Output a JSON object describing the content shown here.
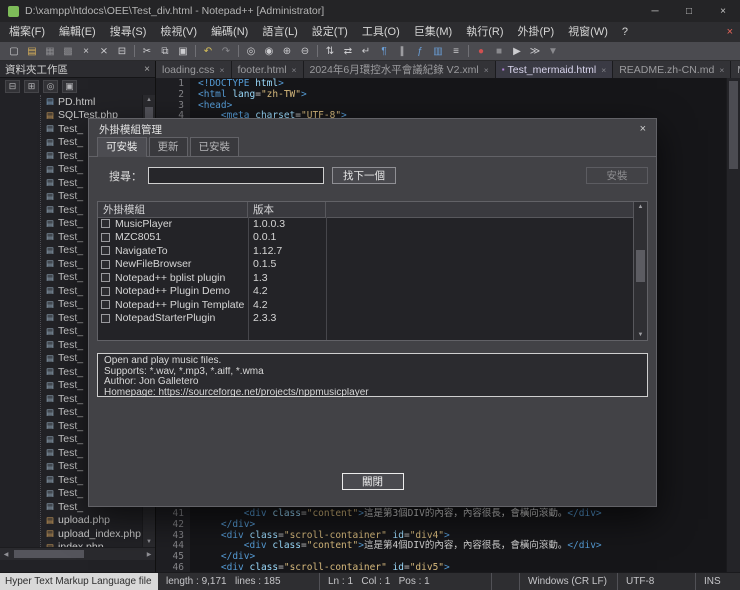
{
  "window": {
    "title": "D:\\xampp\\htdocs\\OEE\\Test_div.html - Notepad++ [Administrator]",
    "minimize": "─",
    "maximize": "□",
    "close": "×",
    "menubar_close": "×"
  },
  "icons": {
    "close": "×",
    "scroll_left": "◀",
    "scroll_right": "▶",
    "scroll_up": "▲",
    "scroll_down": "▼",
    "file": "▤",
    "tab_state": "▪"
  },
  "menu": {
    "items": [
      {
        "id": "file",
        "label": "檔案(F)"
      },
      {
        "id": "edit",
        "label": "編輯(E)"
      },
      {
        "id": "search",
        "label": "搜尋(S)"
      },
      {
        "id": "view",
        "label": "檢視(V)"
      },
      {
        "id": "encoding",
        "label": "編碼(N)"
      },
      {
        "id": "language",
        "label": "語言(L)"
      },
      {
        "id": "settings",
        "label": "設定(T)"
      },
      {
        "id": "tools",
        "label": "工具(O)"
      },
      {
        "id": "macro",
        "label": "巨集(M)"
      },
      {
        "id": "run",
        "label": "執行(R)"
      },
      {
        "id": "plugins",
        "label": "外掛(P)"
      },
      {
        "id": "window",
        "label": "視窗(W)"
      },
      {
        "id": "help",
        "label": "?"
      }
    ]
  },
  "toolbar": {
    "icons": [
      {
        "name": "new-file",
        "glyph": "▢"
      },
      {
        "name": "open-file",
        "glyph": "▤",
        "color": "#d8b05a"
      },
      {
        "name": "save",
        "glyph": "▦",
        "color": "#8a8a8e"
      },
      {
        "name": "save-all",
        "glyph": "▩",
        "color": "#8a8a8e"
      },
      {
        "name": "close-file",
        "glyph": "×"
      },
      {
        "name": "close-all",
        "glyph": "⨯"
      },
      {
        "name": "print",
        "glyph": "⊟"
      },
      {
        "sep": true
      },
      {
        "name": "cut",
        "glyph": "✂"
      },
      {
        "name": "copy",
        "glyph": "⧉"
      },
      {
        "name": "paste",
        "glyph": "▣"
      },
      {
        "sep": true
      },
      {
        "name": "undo",
        "glyph": "↶",
        "color": "#d8c05a"
      },
      {
        "name": "redo",
        "glyph": "↷",
        "color": "#8a8a8e"
      },
      {
        "sep": true
      },
      {
        "name": "find",
        "glyph": "◎"
      },
      {
        "name": "replace",
        "glyph": "◉"
      },
      {
        "name": "zoom-in",
        "glyph": "⊕"
      },
      {
        "name": "zoom-out",
        "glyph": "⊖"
      },
      {
        "sep": true
      },
      {
        "name": "sync-vertical-scroll",
        "glyph": "⇅"
      },
      {
        "name": "sync-horizontal-scroll",
        "glyph": "⇄"
      },
      {
        "name": "word-wrap",
        "glyph": "↵"
      },
      {
        "name": "show-all-characters",
        "glyph": "¶",
        "color": "#6a9fd8"
      },
      {
        "name": "indent-guide",
        "glyph": "∥"
      },
      {
        "name": "function-list",
        "glyph": "ƒ",
        "color": "#6a9fd8"
      },
      {
        "name": "document-map",
        "glyph": "▥",
        "color": "#6a9fd8"
      },
      {
        "name": "document-switcher",
        "glyph": "≡"
      },
      {
        "sep": true
      },
      {
        "name": "record-macro",
        "glyph": "●",
        "color": "#d05050"
      },
      {
        "name": "stop-macro",
        "glyph": "■",
        "color": "#8a8a8e"
      },
      {
        "name": "play-macro",
        "glyph": "▶"
      },
      {
        "name": "run-macro-multiple-times",
        "glyph": "≫"
      },
      {
        "name": "save-macro",
        "glyph": "▼",
        "color": "#8a8a8e"
      }
    ]
  },
  "tabbar": {
    "tabs": [
      {
        "label": "loading.css",
        "active": false
      },
      {
        "label": "footer.html",
        "active": false
      },
      {
        "label": "2024年6月環控水平會議紀錄 V2.xml",
        "active": false
      },
      {
        "label": "Test_mermaid.html",
        "active": true
      },
      {
        "label": "README.zh-CN.md",
        "active": false
      },
      {
        "label": "Mapp",
        "active": false
      }
    ]
  },
  "sidebar": {
    "title": "資料夾工作區",
    "close": "×",
    "panel_icons": [
      {
        "name": "collapse-all",
        "glyph": "⊟"
      },
      {
        "name": "expand-all",
        "glyph": "⊞"
      },
      {
        "name": "locate-current-file",
        "glyph": "◎"
      },
      {
        "name": "select-item",
        "glyph": "▣"
      }
    ],
    "files": [
      {
        "label": "PD.html",
        "type": "html"
      },
      {
        "label": "SQLTest.php",
        "type": "php"
      },
      {
        "label": "Test_",
        "type": "file",
        "repeat": 29
      },
      {
        "label": "upload.php",
        "type": "php"
      },
      {
        "label": "upload_index.php",
        "type": "php"
      },
      {
        "label": "index.php",
        "type": "php"
      }
    ]
  },
  "editor": {
    "total_lines": 46,
    "lines": {
      "1": [
        [
          "tag",
          "<!DOCTYPE "
        ],
        [
          "attr",
          "html"
        ],
        [
          "tag",
          ">"
        ]
      ],
      "2": [
        [
          "tag",
          "<html"
        ],
        [
          "attr",
          " lang"
        ],
        [
          "punct",
          "="
        ],
        [
          "str",
          "\"zh-TW\""
        ],
        [
          "tag",
          ">"
        ]
      ],
      "3": [
        [
          "tag",
          "<head>"
        ]
      ],
      "4": [
        [
          "text",
          "    "
        ],
        [
          "tag",
          "<meta"
        ],
        [
          "attr",
          " charset"
        ],
        [
          "punct",
          "="
        ],
        [
          "str",
          "\"UTF-8\""
        ],
        [
          "tag",
          ">"
        ]
      ],
      "41": [
        [
          "text",
          "        "
        ],
        [
          "tag",
          "<div"
        ],
        [
          "attr",
          " class"
        ],
        [
          "punct",
          "="
        ],
        [
          "str",
          "\"content\""
        ],
        [
          "tag",
          ">"
        ],
        [
          "text",
          "這是第3個DIV的內容，內容很長，會橫向滾動。"
        ],
        [
          "tag",
          "</div>"
        ]
      ],
      "42": [
        [
          "text",
          "    "
        ],
        [
          "tag",
          "</div>"
        ]
      ],
      "43": [
        [
          "text",
          "    "
        ],
        [
          "tag",
          "<div"
        ],
        [
          "attr",
          " class"
        ],
        [
          "punct",
          "="
        ],
        [
          "str",
          "\"scroll-container\""
        ],
        [
          "attr",
          " id"
        ],
        [
          "punct",
          "="
        ],
        [
          "str",
          "\"div4\""
        ],
        [
          "tag",
          ">"
        ]
      ],
      "44": [
        [
          "text",
          "        "
        ],
        [
          "tag",
          "<div"
        ],
        [
          "attr",
          " class"
        ],
        [
          "punct",
          "="
        ],
        [
          "str",
          "\"content\""
        ],
        [
          "tag",
          ">"
        ],
        [
          "text",
          "這是第4個DIV的內容，內容很長，會橫向滾動。"
        ],
        [
          "tag",
          "</div>"
        ]
      ],
      "45": [
        [
          "text",
          "    "
        ],
        [
          "tag",
          "</div>"
        ]
      ],
      "46": [
        [
          "text",
          "    "
        ],
        [
          "tag",
          "<div"
        ],
        [
          "attr",
          " class"
        ],
        [
          "punct",
          "="
        ],
        [
          "str",
          "\"scroll-container\""
        ],
        [
          "attr",
          " id"
        ],
        [
          "punct",
          "="
        ],
        [
          "str",
          "\"div5\""
        ],
        [
          "tag",
          ">"
        ]
      ]
    }
  },
  "dialog": {
    "title": "外掛模組管理",
    "close": "×",
    "tabs": [
      {
        "id": "available",
        "label": "可安裝",
        "selected": true
      },
      {
        "id": "updates",
        "label": "更新",
        "selected": false
      },
      {
        "id": "installed",
        "label": "已安裝",
        "selected": false
      }
    ],
    "search_label": "搜尋：",
    "search_value": "",
    "find_next": "找下一個",
    "install": "安裝",
    "table": {
      "columns": [
        "外掛模組",
        "版本"
      ],
      "rows": [
        {
          "name": "MusicPlayer",
          "version": "1.0.0.3"
        },
        {
          "name": "MZC8051",
          "version": "0.0.1"
        },
        {
          "name": "NavigateTo",
          "version": "1.12.7"
        },
        {
          "name": "NewFileBrowser",
          "version": "0.1.5"
        },
        {
          "name": "Notepad++ bplist plugin",
          "version": "1.3"
        },
        {
          "name": "Notepad++ Plugin Demo",
          "version": "4.2"
        },
        {
          "name": "Notepad++ Plugin Template",
          "version": "4.2"
        },
        {
          "name": "NotepadStarterPlugin",
          "version": "2.3.3"
        }
      ]
    },
    "description": [
      "Open and play music files.",
      "Supports: *.wav, *.mp3, *.aiff, *.wma",
      "Author: Jon Galletero",
      "Homepage: https://sourceforge.net/projects/nppmusicplayer"
    ],
    "close_button": "關閉"
  },
  "status_bar": {
    "doc_type": "Hyper Text Markup Language file",
    "length_info": "length : 9,171   lines : 185",
    "cursor_info": "Ln : 1   Col : 1   Pos : 1",
    "eol": "Windows (CR LF)",
    "encoding": "UTF-8",
    "mode": "INS"
  }
}
